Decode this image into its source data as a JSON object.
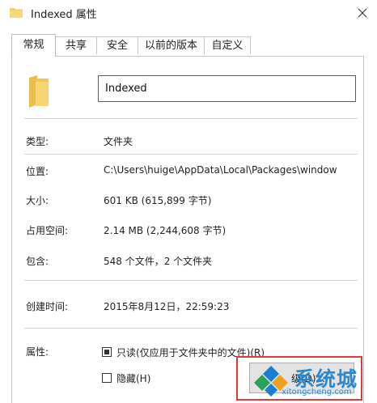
{
  "window": {
    "title": "Indexed 属性",
    "close_symbol": "×"
  },
  "tabs": [
    {
      "label": "常规",
      "active": true
    },
    {
      "label": "共享",
      "active": false
    },
    {
      "label": "安全",
      "active": false
    },
    {
      "label": "以前的版本",
      "active": false
    },
    {
      "label": "自定义",
      "active": false
    }
  ],
  "general": {
    "folder_icon": "folder-icon",
    "name_value": "Indexed",
    "rows": [
      {
        "label": "类型:",
        "value": "文件夹"
      },
      {
        "label": "位置:",
        "value": "C:\\Users\\huige\\AppData\\Local\\Packages\\window"
      },
      {
        "label": "大小:",
        "value": "601 KB (615,899 字节)"
      },
      {
        "label": "占用空间:",
        "value": "2.14 MB (2,244,608 字节)"
      },
      {
        "label": "包含:",
        "value": "548 个文件，2 个文件夹"
      },
      {
        "label": "创建时间:",
        "value": "2015年8月12日，22:59:23"
      }
    ],
    "attributes_label": "属性:",
    "readonly": {
      "label": "只读(仅应用于文件夹中的文件)(R)",
      "checked": true
    },
    "hidden": {
      "label": "隐藏(H)",
      "checked": false
    },
    "advanced_button_text": "级(D)..."
  },
  "watermark": {
    "brand": "系统城",
    "url": "xitongcheng.com"
  },
  "colors": {
    "folder_yellow": "#f3cf6a",
    "highlight_red": "#e23a3a",
    "watermark_blue": "#1a82d4"
  }
}
